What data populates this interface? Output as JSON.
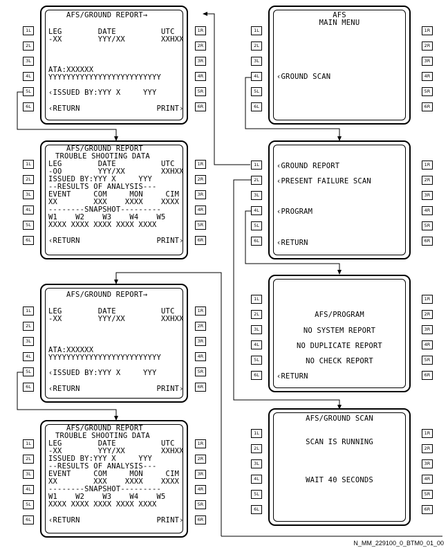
{
  "keys": {
    "left": [
      "1L",
      "2L",
      "3L",
      "4L",
      "5L",
      "6L"
    ],
    "right": [
      "1R",
      "2R",
      "3R",
      "4R",
      "5R",
      "6R"
    ]
  },
  "screens": {
    "s1": {
      "title": "AFS/GROUND REPORT→",
      "lines": [
        "LEG        DATE          UTC",
        "-XX        YYY/XX        XXHXX",
        "",
        "ATA:XXXXXX",
        "YYYYYYYYYYYYYYYYYYYYYYYYY",
        "‹ISSUED BY:YYY X     YYY",
        "‹RETURN                 PRINT›"
      ]
    },
    "s2": {
      "title": "AFS/GROUND REPORT",
      "lines": [
        "TROUBLE SHOOTING DATA",
        "LEG        DATE          UTC",
        "-OO        YYY/XX        XXHXX",
        "ISSUED BY:YYY X     YYY",
        "--RESULTS OF ANALYSIS---",
        "EVENT     COM     MON     CIM",
        "XX        XXX    XXXX    XXXX",
        "--------SNAPSHOT---------",
        "W1    W2    W3    W4    W5",
        "XXXX XXXX XXXX XXXX XXXX",
        "‹RETURN                 PRINT›"
      ]
    },
    "s3": {
      "title": "AFS/GROUND REPORT→",
      "lines": [
        "LEG        DATE          UTC",
        "-XX        YYY/XX        XXHXX",
        "ATA:XXXXXX",
        "YYYYYYYYYYYYYYYYYYYYYYYYY",
        "‹ISSUED BY:YYY X     YYY",
        "‹RETURN                 PRINT›"
      ]
    },
    "s4": {
      "title": "AFS/GROUND REPORT",
      "lines": [
        "TROUBLE SHOOTING DATA",
        "LEG        DATE          UTC",
        "-XX        YYY/XX        XXHXX",
        "ISSUED BY:YYY X     YYY",
        "--RESULTS OF ANALYSIS---",
        "EVENT     COM     MON     CIM",
        "XX        XXX    XXXX    XXXX",
        "--------SNAPSHOT---------",
        "W1    W2    W3    W4    W5",
        "XXXX XXXX XXXX XXXX XXXX",
        "‹RETURN                 PRINT›"
      ]
    },
    "s5": {
      "title": "AFS",
      "subtitle": "MAIN MENU",
      "lines": [
        "‹GROUND SCAN"
      ]
    },
    "s6": {
      "lines": [
        "‹GROUND REPORT",
        "‹PRESENT FAILURE SCAN",
        "‹PROGRAM",
        "‹RETURN"
      ]
    },
    "s7": {
      "lines": [
        "AFS/PROGRAM",
        "NO SYSTEM REPORT",
        "NO DUPLICATE REPORT",
        "NO CHECK REPORT",
        "‹RETURN"
      ]
    },
    "s8": {
      "title": "AFS/GROUND SCAN",
      "lines": [
        "SCAN IS RUNNING",
        "WAIT 40 SECONDS"
      ]
    }
  },
  "reference": "N_MM_229100_0_BTM0_01_00"
}
